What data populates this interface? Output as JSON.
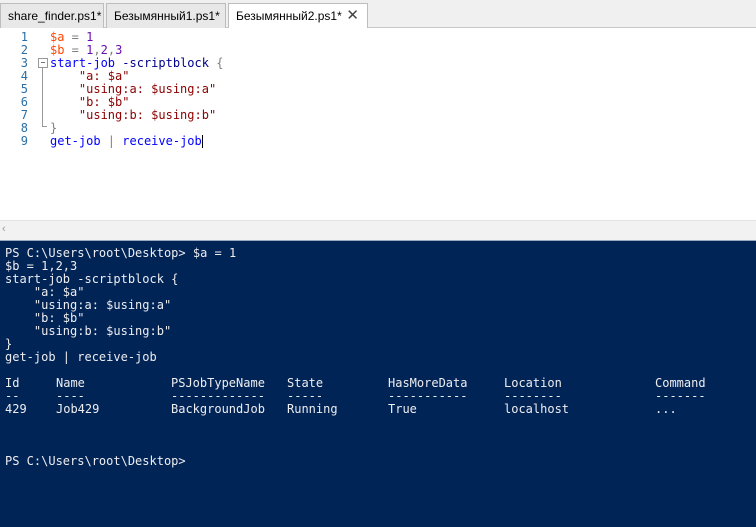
{
  "tabs": [
    {
      "label": "share_finder.ps1*",
      "active": false
    },
    {
      "label": "Безымянный1.ps1*",
      "active": false
    },
    {
      "label": "Безымянный2.ps1*",
      "active": true
    }
  ],
  "editor": {
    "line_numbers": [
      "1",
      "2",
      "3",
      "4",
      "5",
      "6",
      "7",
      "8",
      "9"
    ],
    "lines": [
      [
        {
          "t": "$a",
          "c": "v"
        },
        {
          "t": " = ",
          "c": "o"
        },
        {
          "t": "1",
          "c": "n"
        }
      ],
      [
        {
          "t": "$b",
          "c": "v"
        },
        {
          "t": " = ",
          "c": "o"
        },
        {
          "t": "1",
          "c": "n"
        },
        {
          "t": ",",
          "c": "o"
        },
        {
          "t": "2",
          "c": "n"
        },
        {
          "t": ",",
          "c": "o"
        },
        {
          "t": "3",
          "c": "n"
        }
      ],
      [
        {
          "t": "start-job",
          "c": "c"
        },
        {
          "t": " ",
          "c": ""
        },
        {
          "t": "-scriptblock",
          "c": "p"
        },
        {
          "t": " {",
          "c": "o"
        }
      ],
      [
        {
          "t": "    ",
          "c": ""
        },
        {
          "t": "\"a: $a\"",
          "c": "s"
        }
      ],
      [
        {
          "t": "    ",
          "c": ""
        },
        {
          "t": "\"using:a: $using:a\"",
          "c": "s"
        }
      ],
      [
        {
          "t": "    ",
          "c": ""
        },
        {
          "t": "\"b: $b\"",
          "c": "s"
        }
      ],
      [
        {
          "t": "    ",
          "c": ""
        },
        {
          "t": "\"using:b: $using:b\"",
          "c": "s"
        }
      ],
      [
        {
          "t": "}",
          "c": "o"
        }
      ],
      [
        {
          "t": "get-job",
          "c": "c"
        },
        {
          "t": " | ",
          "c": "o"
        },
        {
          "t": "receive-job",
          "c": "c"
        }
      ]
    ],
    "fold_marker": "−"
  },
  "scrollbar": {
    "left_arrow": "‹"
  },
  "console": {
    "echo_lines": [
      "PS C:\\Users\\root\\Desktop> $a = 1",
      "$b = 1,2,3",
      "start-job -scriptblock {",
      "    \"a: $a\"",
      "    \"using:a: $using:a\"",
      "    \"b: $b\"",
      "    \"using:b: $using:b\"",
      "}",
      "get-job | receive-job"
    ],
    "table": {
      "columns": [
        "Id",
        "Name",
        "PSJobTypeName",
        "State",
        "HasMoreData",
        "Location",
        "Command"
      ],
      "separators": [
        "--",
        "----",
        "-------------",
        "-----",
        "-----------",
        "--------",
        "-------"
      ],
      "rows": [
        [
          "429",
          "Job429",
          "BackgroundJob",
          "Running",
          "True",
          "localhost",
          "..."
        ]
      ]
    },
    "prompt": "PS C:\\Users\\root\\Desktop>"
  },
  "colors": {
    "console_bg": "#012456",
    "console_fg": "#eeedf0",
    "variable": "#ff4500",
    "string": "#8b0000",
    "command": "#0000ff",
    "parameter": "#00008b",
    "number": "#6a0dad",
    "line_number": "#2b6fa6"
  },
  "icons": {
    "tab_close": "close-icon"
  }
}
